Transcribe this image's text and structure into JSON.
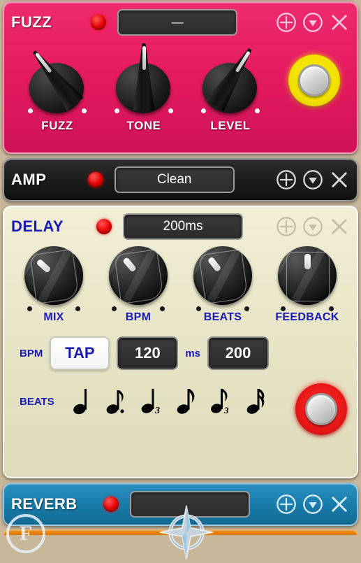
{
  "app": {
    "background_color": "#c2af91"
  },
  "pedals": {
    "top_partial": {
      "name": "",
      "color": "#2d28b0",
      "preset_value": "",
      "led_on": true
    },
    "fuzz": {
      "name": "FUZZ",
      "color": "#e41a60",
      "preset_value": "—",
      "preset_is_empty": true,
      "led_on": true,
      "led_color": "#ff0000",
      "knobs": [
        {
          "label": "FUZZ",
          "angle": -38
        },
        {
          "label": "TONE",
          "angle": 0
        },
        {
          "label": "LEVEL",
          "angle": 32
        }
      ],
      "footswitch": {
        "name": "fuzz-footswitch",
        "ring_color": "#f2e000",
        "engaged": false
      }
    },
    "amp": {
      "name": "AMP",
      "color": "#1b1b1b",
      "preset_value": "Clean",
      "led_on": true
    },
    "delay": {
      "name": "DELAY",
      "color": "#e9e6c9",
      "title_color": "#1a1ab4",
      "preset_value": "200ms",
      "led_on": true,
      "knobs": [
        {
          "label": "MIX",
          "angle": -48
        },
        {
          "label": "BPM",
          "angle": -40
        },
        {
          "label": "BEATS",
          "angle": -38
        },
        {
          "label": "FEEDBACK",
          "angle": 0
        }
      ],
      "bpm_row": {
        "label": "BPM",
        "tap_label": "TAP",
        "bpm_value": "120",
        "ms_label": "ms",
        "ms_value": "200"
      },
      "beats_row": {
        "label": "BEATS",
        "notes": [
          {
            "name": "quarter-note",
            "glyph": "quarter"
          },
          {
            "name": "dotted-quarter-note",
            "glyph": "dotted-quarter"
          },
          {
            "name": "quarter-triplet-note",
            "glyph": "quarter-triplet"
          },
          {
            "name": "eighth-note",
            "glyph": "eighth"
          },
          {
            "name": "eighth-triplet-note",
            "glyph": "eighth-triplet"
          },
          {
            "name": "sixteenth-note",
            "glyph": "sixteenth"
          }
        ]
      },
      "footswitch": {
        "name": "delay-footswitch",
        "ring_color": "#e81717",
        "engaged": true
      }
    },
    "reverb": {
      "name": "REVERB",
      "color": "#1a7fae",
      "preset_value": "",
      "led_on": true
    }
  },
  "header_buttons": {
    "add": "add-icon",
    "dropdown": "chevron-down-icon",
    "close": "close-icon"
  },
  "overlays": {
    "cursor": "compass-cursor",
    "watermark": "F"
  }
}
